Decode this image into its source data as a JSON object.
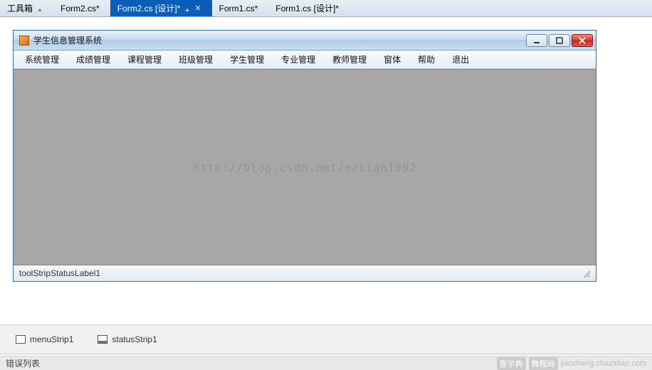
{
  "tabs": [
    {
      "label": "工具箱",
      "pinned": true
    },
    {
      "label": "Form2.cs*"
    },
    {
      "label": "Form2.cs [设计]*",
      "active": true,
      "pinned": true,
      "closable": true
    },
    {
      "label": "Form1.cs*"
    },
    {
      "label": "Form1.cs [设计]*"
    }
  ],
  "window": {
    "title": "学生信息管理系统"
  },
  "menu": {
    "items": [
      "系统管理",
      "成绩管理",
      "课程管理",
      "班级管理",
      "学生管理",
      "专业管理",
      "教师管理",
      "窗体",
      "帮助",
      "退出"
    ]
  },
  "watermark": "http://blog.csdn.net/erlian1992",
  "status": {
    "label": "toolStripStatusLabel1"
  },
  "tray": {
    "items": [
      "menuStrip1",
      "statusStrip1"
    ]
  },
  "bottom": {
    "label": "错误列表",
    "site1": "查字典",
    "site2": "教程网",
    "site_url": "jiaocheng.chazidian.com"
  }
}
